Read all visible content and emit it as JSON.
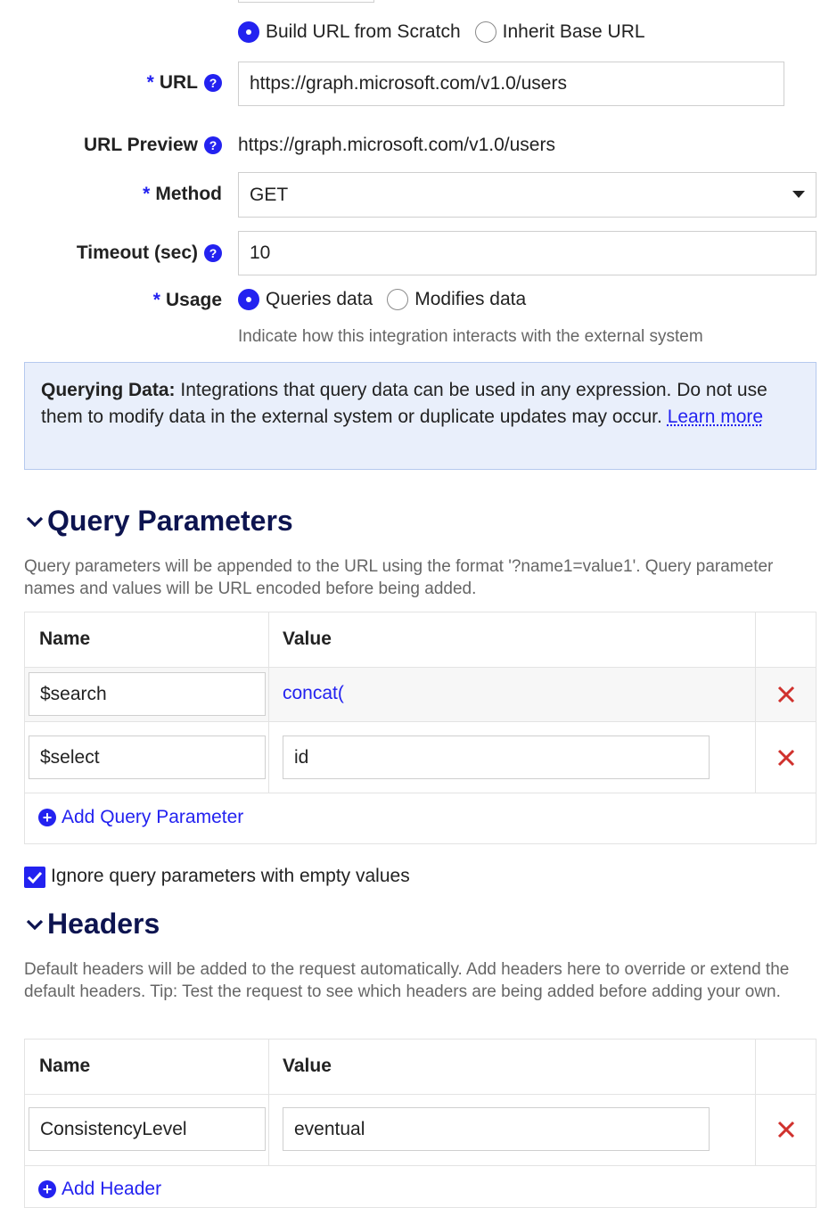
{
  "url_mode": {
    "options": [
      {
        "label": "Build URL from Scratch",
        "selected": true
      },
      {
        "label": "Inherit Base URL",
        "selected": false
      }
    ]
  },
  "url": {
    "label": "URL",
    "value": "https://graph.microsoft.com/v1.0/users"
  },
  "url_preview": {
    "label": "URL Preview",
    "value": "https://graph.microsoft.com/v1.0/users"
  },
  "method": {
    "label": "Method",
    "value": "GET"
  },
  "timeout": {
    "label": "Timeout (sec)",
    "value": "10"
  },
  "usage": {
    "label": "Usage",
    "options": [
      {
        "label": "Queries data",
        "selected": true
      },
      {
        "label": "Modifies data",
        "selected": false
      }
    ],
    "hint": "Indicate how this integration interacts with the external system"
  },
  "info": {
    "title": "Querying Data:",
    "text": " Integrations that query data can be used in any expression. Do not use them to modify data in the external system or duplicate updates may occur. ",
    "link": "Learn more"
  },
  "query_params": {
    "title": "Query Parameters",
    "description": "Query parameters will be appended to the URL using the format '?name1=value1'. Query parameter names and values will be URL encoded before being added.",
    "col_name": "Name",
    "col_value": "Value",
    "rows": [
      {
        "name": "$search",
        "value": "concat("
      },
      {
        "name": "$select",
        "value": "id"
      }
    ],
    "add_label": "Add Query Parameter",
    "ignore_empty_label": "Ignore query parameters with empty values",
    "ignore_empty_checked": true
  },
  "headers": {
    "title": "Headers",
    "description": "Default headers will be added to the request automatically. Add headers here to override or extend the default headers. Tip: Test the request to see which headers are being added before adding your own.",
    "col_name": "Name",
    "col_value": "Value",
    "rows": [
      {
        "name": "ConsistencyLevel",
        "value": "eventual"
      }
    ],
    "add_label": "Add Header"
  },
  "colors": {
    "accent": "#2322f0",
    "delete": "#d0312d",
    "heading": "#0d1450",
    "info_bg": "#e9effb"
  }
}
